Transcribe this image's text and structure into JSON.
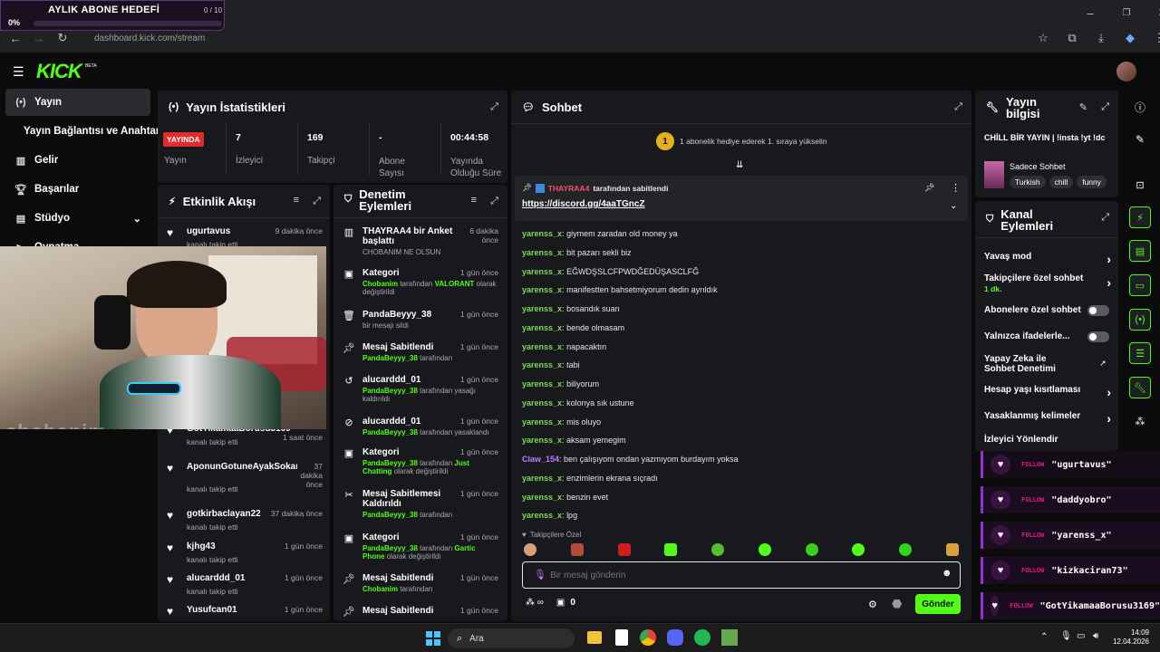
{
  "browser": {
    "url": "dashboard.kick.com/stream"
  },
  "goal": {
    "title": "AYLIK ABONE HEDEFİ",
    "count": "0 / 10",
    "percent": "0%",
    "progress": 0
  },
  "brand": {
    "logo": "KICK",
    "beta": "BETA",
    "accent": "#53fc18"
  },
  "sidebar": {
    "items": [
      {
        "label": "Yayın",
        "icon": "broadcast-icon"
      },
      {
        "label": "Yayın Bağlantısı ve Anahtarı",
        "icon": ""
      },
      {
        "label": "Gelir",
        "icon": "chart-icon"
      },
      {
        "label": "Başarılar",
        "icon": "trophy-icon"
      },
      {
        "label": "Stüdyo",
        "icon": "studio-icon"
      },
      {
        "label": "Oynatma",
        "icon": "play-icon"
      }
    ]
  },
  "stats": {
    "title": "Yayın İstatistikleri",
    "live_badge": "YAYINDA",
    "live_label": "Yayın",
    "viewers": {
      "value": "7",
      "label": "İzleyici"
    },
    "followers": {
      "value": "169",
      "label": "Takipçi"
    },
    "subs": {
      "value": "-",
      "label": "Abone Sayısı"
    },
    "duration": {
      "value": "00:44:58",
      "label": "Yayında Olduğu Süre"
    }
  },
  "activity": {
    "title": "Etkinlik Akışı",
    "items": [
      {
        "name": "ugurtavus",
        "sub": "kanalı takip etti",
        "time": "9 dakika önce"
      },
      {
        "name": "GotYikamaaBorusu3169",
        "sub": "kanalı takip etti",
        "time": "1 saat önce"
      },
      {
        "name": "AponunGotuneAyakSokan3",
        "sub": "kanalı takip etti",
        "time": "37 dakika önce"
      },
      {
        "name": "gotkirbaclayan22",
        "sub": "kanalı takip etti",
        "time": "37 dakika önce"
      },
      {
        "name": "kjhg43",
        "sub": "kanalı takip etti",
        "time": "1 gün önce"
      },
      {
        "name": "alucarddd_01",
        "sub": "kanalı takip etti",
        "time": "1 gün önce"
      },
      {
        "name": "Yusufcan01",
        "sub": "",
        "time": "1 gün önce"
      }
    ]
  },
  "webcam": {
    "overlay": "chobanim"
  },
  "moderation": {
    "title": "Denetim Eylemleri",
    "items": [
      {
        "title": "THAYRAA4 bir Anket başlattı",
        "sub": "CHOBANIM NE OLSUN",
        "time": "6 dakika önce",
        "icon": "poll-icon"
      },
      {
        "title": "Kategori",
        "sub_user": "Chobanim",
        "sub_mid": " tarafından ",
        "sub_val": "VALORANT",
        "sub_end": " olarak değiştirildi",
        "time": "1 gün önce",
        "icon": "category-icon"
      },
      {
        "title": "PandaBeyyy_38",
        "sub": "bir mesajı sildi",
        "time": "1 gün önce",
        "icon": "trash-icon"
      },
      {
        "title": "Mesaj Sabitlendi",
        "sub_user": "PandaBeyyy_38",
        "sub_mid": " tarafından",
        "time": "1 gün önce",
        "icon": "pin-icon"
      },
      {
        "title": "alucarddd_01",
        "sub_user": "PandaBeyyy_38",
        "sub_mid": " tarafından yasağı kaldırıldı",
        "time": "1 gün önce",
        "icon": "undo-icon"
      },
      {
        "title": "alucarddd_01",
        "sub_user": "PandaBeyyy_38",
        "sub_mid": " tarafından yasaklandı",
        "time": "1 gün önce",
        "icon": "ban-icon"
      },
      {
        "title": "Kategori",
        "sub_user": "PandaBeyyy_38",
        "sub_mid": " tarafından ",
        "sub_val": "Just Chatting",
        "sub_end": " olarak değiştirildi",
        "time": "1 gün önce",
        "icon": "category-icon"
      },
      {
        "title": "Mesaj Sabitlemesi Kaldırıldı",
        "sub_user": "PandaBeyyy_38",
        "sub_mid": " tarafından",
        "time": "1 gün önce",
        "icon": "unpin-icon"
      },
      {
        "title": "Kategori",
        "sub_user": "PandaBeyyy_38",
        "sub_mid": " tarafından ",
        "sub_val": "Gartic Phone",
        "sub_end": " olarak değiştirildi",
        "time": "1 gün önce",
        "icon": "category-icon"
      },
      {
        "title": "Mesaj Sabitlendi",
        "sub_user": "Chobanim",
        "sub_mid": " tarafından",
        "time": "1 gün önce",
        "icon": "pin-icon"
      },
      {
        "title": "Mesaj Sabitlendi",
        "sub": "",
        "time": "1 gün önce",
        "icon": "pin-icon"
      }
    ]
  },
  "chat": {
    "title": "Sohbet",
    "gift_banner": "1 abonelik hediye ederek 1. sıraya yükselin",
    "gift_rank": "1",
    "pinned": {
      "by": "THAYRAA4",
      "by_suffix": " tarafından sabitlendi",
      "link": "https://discord.gg/4aaTGncZ"
    },
    "messages": [
      {
        "user": "yarenss_x",
        "text": "giymem zaradan old money ya"
      },
      {
        "user": "yarenss_x",
        "text": "bit pazarı sekli biz"
      },
      {
        "user": "yarenss_x",
        "text": "EĞWDŞSLCFPWDĞEDÜŞASCLFĞ"
      },
      {
        "user": "yarenss_x",
        "text": "manifestten bahsetmiyorum dedin ayrıldık"
      },
      {
        "user": "yarenss_x",
        "text": "bosandık suan"
      },
      {
        "user": "yarenss_x",
        "text": "bende olmasam"
      },
      {
        "user": "yarenss_x",
        "text": "napacaktın"
      },
      {
        "user": "yarenss_x",
        "text": "tabi"
      },
      {
        "user": "yarenss_x",
        "text": "biliyorum"
      },
      {
        "user": "yarenss_x",
        "text": "kolonya sık ustune"
      },
      {
        "user": "yarenss_x",
        "text": "mis oluyo"
      },
      {
        "user": "yarenss_x",
        "text": "aksam yemegim"
      },
      {
        "user": "Claw_154",
        "text": "ben çalışıyom ondan yazmıyom burdayım yoksa"
      },
      {
        "user": "yarenss_x",
        "text": "enzimlerin ekrana sıçradı"
      },
      {
        "user": "yarenss_x",
        "text": "benzin evet"
      },
      {
        "user": "yarenss_x",
        "text": "lpg"
      }
    ],
    "emote_label": "Takipçilere Özel",
    "input_placeholder": "Bir mesaj gönderin",
    "points": "0",
    "send_label": "Gönder"
  },
  "stream_info": {
    "title": "Yayın bilgisi",
    "stream_title": "CHİLL BİR YAYIN | !insta !yt !dc",
    "category": "Sadece Sohbet",
    "tags": [
      "Turkish",
      "chill",
      "funny"
    ]
  },
  "channel_actions": {
    "title": "Kanal Eylemleri",
    "items": [
      {
        "label": "Yavaş mod",
        "type": "chevron"
      },
      {
        "label": "Takipçilere özel sohbet",
        "sub": "1 dk.",
        "type": "chevron"
      },
      {
        "label": "Abonelere özel sohbet",
        "type": "toggle"
      },
      {
        "label": "Yalnızca ifadelerle...",
        "type": "toggle"
      },
      {
        "label": "Yapay Zeka ile Sohbet Denetimi",
        "type": "external"
      },
      {
        "label": "Hesap yaşı kısıtlaması",
        "type": "chevron"
      },
      {
        "label": "Yasaklanmış kelimeler",
        "type": "chevron"
      },
      {
        "label": "İzleyici Yönlendir",
        "type": "none"
      }
    ]
  },
  "follow_alerts": {
    "label": "FOLLOW",
    "names": [
      "\"ugurtavus\"",
      "\"daddyobro\"",
      "\"yarenss_x\"",
      "\"kizkaciran73\"",
      "\"GotYikamaaBorusu3169\""
    ]
  },
  "taskbar": {
    "search": "Ara",
    "time": "14:09",
    "date": "12.04.2026"
  }
}
